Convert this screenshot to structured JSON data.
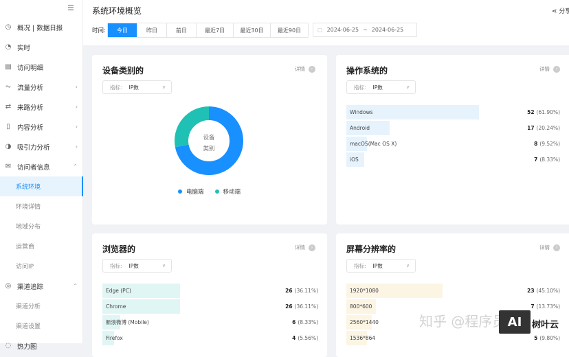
{
  "sidebar": {
    "items": [
      {
        "label": "概况 | 数据日报",
        "icon": "gauge-icon",
        "glyph": "◷"
      },
      {
        "label": "实时",
        "icon": "clock-icon",
        "glyph": "◔"
      },
      {
        "label": "访问明细",
        "icon": "list-search-icon",
        "glyph": "▤"
      },
      {
        "label": "流量分析",
        "icon": "traffic-icon",
        "glyph": "⏦",
        "chev": "›"
      },
      {
        "label": "来路分析",
        "icon": "source-icon",
        "glyph": "⇄",
        "chev": "›"
      },
      {
        "label": "内容分析",
        "icon": "document-icon",
        "glyph": "▯",
        "chev": "›"
      },
      {
        "label": "吸引力分析",
        "icon": "magnet-icon",
        "glyph": "◑",
        "chev": "›"
      },
      {
        "label": "访问者信息",
        "icon": "mail-icon",
        "glyph": "✉",
        "chev": "⌃"
      },
      {
        "label": "系统环境"
      },
      {
        "label": "环境详情"
      },
      {
        "label": "地域分布"
      },
      {
        "label": "运营商"
      },
      {
        "label": "访问IP"
      },
      {
        "label": "渠道追踪",
        "icon": "target-icon",
        "glyph": "◎",
        "chev": "⌃"
      },
      {
        "label": "渠道分析"
      },
      {
        "label": "渠道设置"
      },
      {
        "label": "热力图",
        "icon": "heatmap-icon",
        "glyph": "◌"
      }
    ]
  },
  "header": {
    "title": "系统环境概览",
    "share": "分享",
    "time_label": "时间:",
    "tabs": [
      "今日",
      "昨日",
      "前日",
      "最近7日",
      "最近30日",
      "最近90日"
    ],
    "date_start": "2024-06-25",
    "date_sep": "~",
    "date_end": "2024-06-25"
  },
  "detail": "详情",
  "metric_key": "指标:",
  "metric_value": "IP数",
  "device": {
    "title": "设备类别的",
    "center_line1": "设备",
    "center_line2": "类别",
    "chart_data": {
      "type": "pie",
      "series": [
        {
          "name": "电脑端",
          "value": 0.72,
          "color": "#1890ff"
        },
        {
          "name": "移动端",
          "value": 0.28,
          "color": "#1fc1b4"
        }
      ]
    }
  },
  "os": {
    "title": "操作系统的",
    "color": "#e6f3fd",
    "rows": [
      {
        "name": "Windows",
        "count": "52",
        "pct": "(61.90%)",
        "p": 61.9
      },
      {
        "name": "Android",
        "count": "17",
        "pct": "(20.24%)",
        "p": 20.24
      },
      {
        "name": "macOS(Mac OS X)",
        "count": "8",
        "pct": "(9.52%)",
        "p": 9.52
      },
      {
        "name": "iOS",
        "count": "7",
        "pct": "(8.33%)",
        "p": 8.33
      }
    ]
  },
  "browser": {
    "title": "浏览器的",
    "color": "#e0f6f4",
    "rows": [
      {
        "name": "Edge (PC)",
        "count": "26",
        "pct": "(36.11%)",
        "p": 36.11
      },
      {
        "name": "Chrome",
        "count": "26",
        "pct": "(36.11%)",
        "p": 36.11
      },
      {
        "name": "新浪微博 (Mobile)",
        "count": "6",
        "pct": "(8.33%)",
        "p": 8.33
      },
      {
        "name": "Firefox",
        "count": "4",
        "pct": "(5.56%)",
        "p": 5.56
      }
    ]
  },
  "screen": {
    "title": "屏幕分辨率的",
    "color": "#fdf5e4",
    "rows": [
      {
        "name": "1920*1080",
        "count": "23",
        "pct": "(45.10%)",
        "p": 45.1
      },
      {
        "name": "800*600",
        "count": "7",
        "pct": "(13.73%)",
        "p": 13.73
      },
      {
        "name": "2560*1440",
        "p": 11.76
      },
      {
        "name": "1536*864",
        "count": "5",
        "pct": "(9.80%)",
        "p": 9.8
      }
    ]
  },
  "watermark": {
    "text": "知乎 @程序员",
    "logo": "AI",
    "brand": "树叶云"
  }
}
